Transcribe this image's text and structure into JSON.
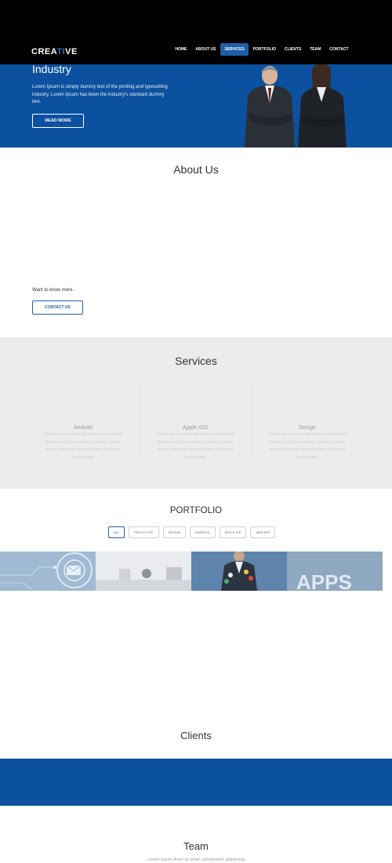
{
  "brand": {
    "logo_left": "CREA",
    "logo_accent": "TI",
    "logo_right": "VE",
    "tagline": ""
  },
  "nav": {
    "items": [
      {
        "label": "HOME"
      },
      {
        "label": "ABOUT US"
      },
      {
        "label": "SERVICES"
      },
      {
        "label": "PORTFOLIO"
      },
      {
        "label": "CLIENTS"
      },
      {
        "label": "TEAM"
      },
      {
        "label": "CONTACT"
      }
    ],
    "active_index": 2
  },
  "hero": {
    "title": "Industry",
    "text": "Lorem Ipsum is simply dummy text of the printing and typesetting industry. Lorem Ipsum has been the industry's standard dummy text.",
    "button": "READ MORE"
  },
  "about": {
    "title": "About Us",
    "want_more": "Want to know more..",
    "button": "CONTACT US"
  },
  "services": {
    "title": "Services",
    "items": [
      {
        "name": "Android",
        "text": "Lorem Ipsum is simply dummy text of the printing and typesetting industry. Lorem Ipsum has been the industry's standard dummy text."
      },
      {
        "name": "Apple IOS",
        "text": "Lorem Ipsum is simply dummy text of the printing and typesetting industry. Lorem Ipsum has been the industry's standard dummy text."
      },
      {
        "name": "Design",
        "text": "Lorem Ipsum is simply dummy text of the printing and typesetting industry. Lorem Ipsum has been the industry's standard dummy text."
      }
    ]
  },
  "portfolio": {
    "title": "PORTFOLIO",
    "filters": [
      "ALL",
      "PROTOTYPE",
      "DESIGN",
      "ANDROID",
      "APPLE IOS",
      "WEB APP"
    ],
    "active_filter": 0,
    "tile4_text": "APPS"
  },
  "clients": {
    "title": "Clients"
  },
  "team": {
    "title": "Team",
    "subtitle": "Lorem ipsum dolor sit amet, consectetur adipiscing"
  },
  "colors": {
    "primary": "#0c519f",
    "active_nav": "#1e5fa8",
    "services_bg": "#ececec",
    "topbar": "#000000"
  }
}
